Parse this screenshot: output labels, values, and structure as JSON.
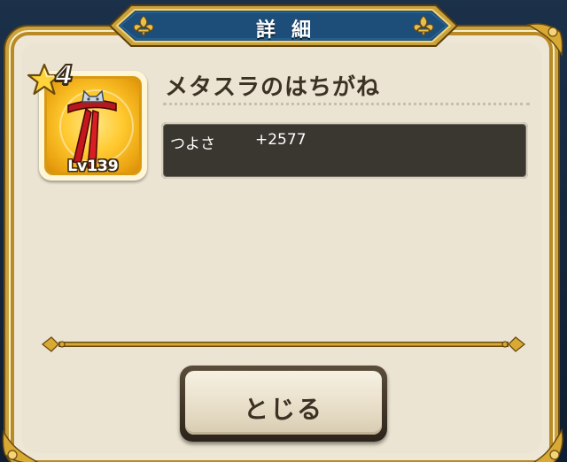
{
  "dialog": {
    "title": "詳細",
    "close_label": "とじる"
  },
  "item": {
    "name": "メタスラのはちがね",
    "rarity": "4",
    "level": "Lv139",
    "icon": "headband-icon"
  },
  "stats": [
    {
      "label": "つよさ",
      "value": "+2577"
    }
  ],
  "colors": {
    "parchment": "#ece4d2",
    "gold_trim": "#caa23c",
    "banner_blue": "#1d4e7a",
    "stat_box": "#3a3630",
    "text_dark": "#3b3224"
  }
}
